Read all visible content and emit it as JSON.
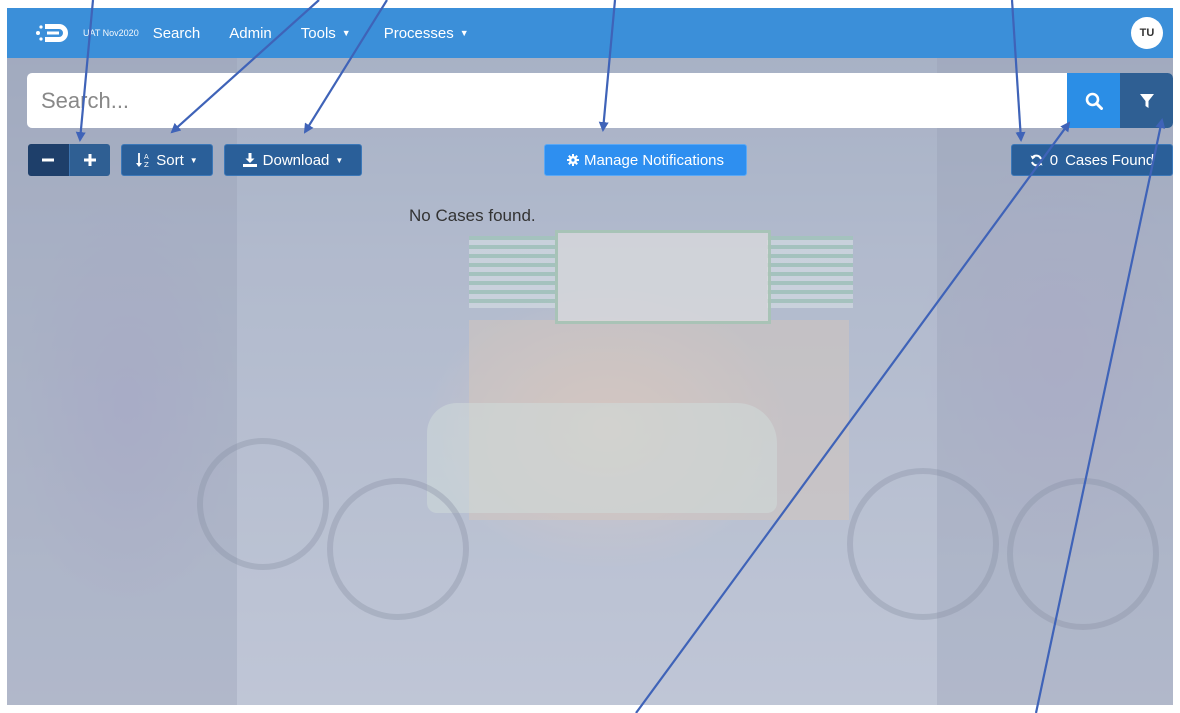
{
  "nav": {
    "brand_sub": "UAT Nov2020",
    "items": [
      {
        "label": "Search",
        "has_caret": false
      },
      {
        "label": "Admin",
        "has_caret": false
      },
      {
        "label": "Tools",
        "has_caret": true
      },
      {
        "label": "Processes",
        "has_caret": true
      }
    ],
    "avatar_initials": "TU",
    "color": "#3b8fd9"
  },
  "search": {
    "placeholder": "Search...",
    "value": "",
    "search_icon": "search-icon",
    "filter_icon": "filter-icon"
  },
  "toolbar": {
    "zoom_out_icon": "minus-icon",
    "zoom_in_icon": "plus-icon",
    "sort_label": "Sort",
    "sort_icon": "sort-alpha-icon",
    "download_label": "Download",
    "download_icon": "download-icon",
    "notifications_label": "Manage Notifications",
    "notifications_icon": "gear-icon",
    "cases_found_count": "0",
    "cases_found_label": "Cases Found",
    "refresh_icon": "refresh-icon"
  },
  "results": {
    "empty_message": "No Cases found."
  },
  "colors": {
    "primary": "#2e8ff0",
    "dark_button": "#24558e",
    "arrow": "#3f63b8"
  }
}
